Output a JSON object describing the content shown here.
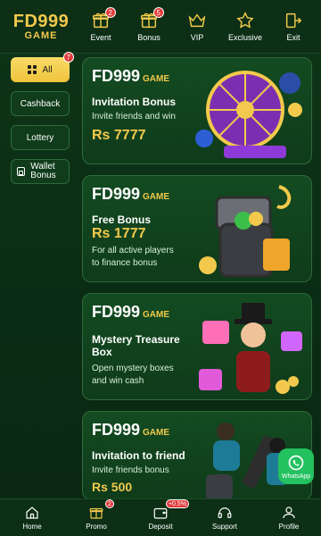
{
  "header": {
    "logo": {
      "main": "FD999",
      "sub": "GAME"
    },
    "nav": [
      {
        "label": "Event",
        "badge": "2",
        "icon": "gift-icon"
      },
      {
        "label": "Bonus",
        "badge": "5",
        "icon": "gift-icon"
      },
      {
        "label": "VIP",
        "badge": "",
        "icon": "crown-icon"
      },
      {
        "label": "Exclusive",
        "badge": "",
        "icon": "star-icon"
      },
      {
        "label": "Exit",
        "badge": "",
        "icon": "exit-icon"
      }
    ]
  },
  "sidebar": {
    "all_badge": "7",
    "items": [
      {
        "label": "All"
      },
      {
        "label": "Cashback"
      },
      {
        "label": "Lottery"
      },
      {
        "label": "Wallet Bonus"
      }
    ]
  },
  "cards": [
    {
      "brand": "FD999",
      "brand_sub": "GAME",
      "title": "Invitation Bonus",
      "desc1": "Invite friends and win",
      "desc2": "",
      "amount": "Rs 7777"
    },
    {
      "brand": "FD999",
      "brand_sub": "GAME",
      "title": "Free Bonus",
      "amount": "Rs 1777",
      "desc1": "For all active players",
      "desc2": "to finance bonus"
    },
    {
      "brand": "FD999",
      "brand_sub": "GAME",
      "title": "Mystery Treasure",
      "title2": "Box",
      "desc1": "Open mystery boxes",
      "desc2": "and win cash",
      "amount": ""
    },
    {
      "brand": "FD999",
      "brand_sub": "GAME",
      "title": "Invitation to friend",
      "desc1": "Invite friends bonus",
      "desc2": "",
      "amount": "Rs 500"
    }
  ],
  "bottom_nav": [
    {
      "label": "Home",
      "badge": "",
      "icon": "home-icon"
    },
    {
      "label": "Promo",
      "badge": "2",
      "icon": "gift-icon"
    },
    {
      "label": "Deposit",
      "badge": "+0.5%",
      "icon": "wallet-icon"
    },
    {
      "label": "Support",
      "badge": "",
      "icon": "headset-icon"
    },
    {
      "label": "Profile",
      "badge": "",
      "icon": "profile-icon"
    }
  ],
  "whatsapp": {
    "label": "WhatsApp"
  },
  "colors": {
    "accent": "#f2c94c",
    "background": "#0b2d14",
    "badge": "#e23a3a"
  }
}
